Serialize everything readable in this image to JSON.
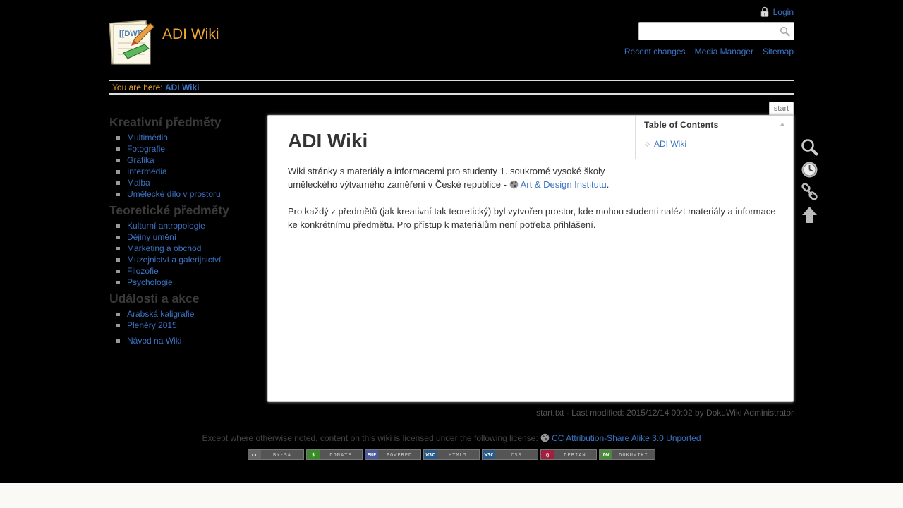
{
  "header": {
    "site_title": "ADI Wiki",
    "login_label": "Login",
    "search_placeholder": "",
    "links": [
      "Recent changes",
      "Media Manager",
      "Sitemap"
    ]
  },
  "breadcrumb": {
    "prefix": "You are here: ",
    "current": "ADI Wiki"
  },
  "sidebar": {
    "sections": [
      {
        "heading": "Kreativní předměty",
        "items": [
          "Multimédia",
          "Fotografie",
          "Grafika",
          "Intermédia",
          "Malba",
          "Umělecké dílo v prostoru"
        ]
      },
      {
        "heading": "Teoretické předměty",
        "items": [
          "Kulturní antropologie",
          "Dějiny umění",
          "Marketing a obchod",
          "Muzejnictví a galerijnictví",
          "Filozofie",
          "Psychologie"
        ]
      },
      {
        "heading": "Události a akce",
        "items": [
          "Arabská kaligrafie",
          "Plenéry 2015"
        ]
      }
    ],
    "extra_item": "Návod na Wiki"
  },
  "page_tab": "start",
  "content": {
    "title": "ADI Wiki",
    "p1_text": "Wiki stránky s materiály a informacemi pro studenty 1. soukromé vysoké školy uměleckého výtvarného zaměření v České republice - ",
    "p1_link": "Art & Design Institutu",
    "p1_end": ".",
    "p2_text": "Pro každý z předmětů (jak kreativní tak teoretický) byl vytvořen prostor, kde mohou studenti nalézt materiály a informace ke konkrétnímu předmětu. Pro přístup k materiálům není potřeba přihlášení."
  },
  "toc": {
    "heading": "Table of Contents",
    "items": [
      "ADI Wiki"
    ]
  },
  "page_tools": [
    "search-icon",
    "old-revisions-icon",
    "backlinks-icon",
    "back-to-top-icon"
  ],
  "docinfo": "start.txt · Last modified: 2015/12/14 09:02 by DokuWiki Administrator",
  "license": {
    "text": "Except where otherwise noted, content on this wiki is licensed under the following license: ",
    "link": "CC Attribution-Share Alike 3.0 Unported"
  },
  "badges": [
    {
      "tag": "cc",
      "text": "BY-SA",
      "color": "#666666"
    },
    {
      "tag": "$",
      "text": "DONATE",
      "color": "#3a8a2a"
    },
    {
      "tag": "PHP",
      "text": "POWERED",
      "color": "#4a5a9a"
    },
    {
      "tag": "W3C",
      "text": "HTML5",
      "color": "#2a5a8a"
    },
    {
      "tag": "W3C",
      "text": "CSS",
      "color": "#2a5a8a"
    },
    {
      "tag": "@",
      "text": "DEBIAN",
      "color": "#a02040"
    },
    {
      "tag": "DW",
      "text": "DOKUWIKI",
      "color": "#4a8a3a"
    }
  ],
  "colors": {
    "background": "#000000",
    "link": "#3b73c4",
    "title": "#f0a830",
    "footer_strip": "#faf9f6"
  }
}
